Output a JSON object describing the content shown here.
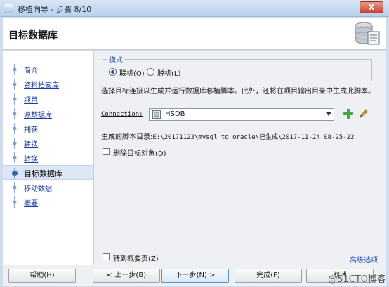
{
  "window": {
    "title": "移植向导 - 步骤 8/10",
    "close_label": "X"
  },
  "header": {
    "title": "目标数据库"
  },
  "nav": {
    "items": [
      {
        "label": "简介"
      },
      {
        "label": "资料档案库"
      },
      {
        "label": "项目"
      },
      {
        "label": "源数据库"
      },
      {
        "label": "捕获"
      },
      {
        "label": "转换"
      },
      {
        "label": "转换"
      },
      {
        "label": "目标数据库"
      },
      {
        "label": "移动数据"
      },
      {
        "label": "概要"
      }
    ],
    "active_index": 7
  },
  "mode": {
    "legend": "模式",
    "options": [
      {
        "label": "联机(O)",
        "selected": true
      },
      {
        "label": "脱机(L)",
        "selected": false
      }
    ]
  },
  "description": "选择目标连接以生成并运行数据库移植脚本。此外，还将在项目输出目录中生成此脚本。",
  "connection": {
    "label": "Connection:",
    "value": "HSDB",
    "icon": "database-icon"
  },
  "actions": {
    "add_icon": "plus-icon",
    "edit_icon": "pencil-icon"
  },
  "script_dir": {
    "label": "生成的脚本目录:",
    "path": "E:\\20171123\\mysql_to_oracle\\已生成\\2017-11-24_08-25-22"
  },
  "drop_targets": {
    "label": "删除目标对象(D)",
    "checked": false
  },
  "goto_summary": {
    "label": "转到概要页(Z)",
    "checked": false
  },
  "advanced_link": "高级选项",
  "buttons": {
    "help": "帮助(H)",
    "back": "< 上一步(B)",
    "next": "下一步(N) >",
    "finish": "完成(F)",
    "cancel": "取消"
  },
  "watermark": "@51CTO博客",
  "colors": {
    "link": "#1f3f9c",
    "accent": "#5c93c9",
    "active_nav": "#dce6f4"
  }
}
